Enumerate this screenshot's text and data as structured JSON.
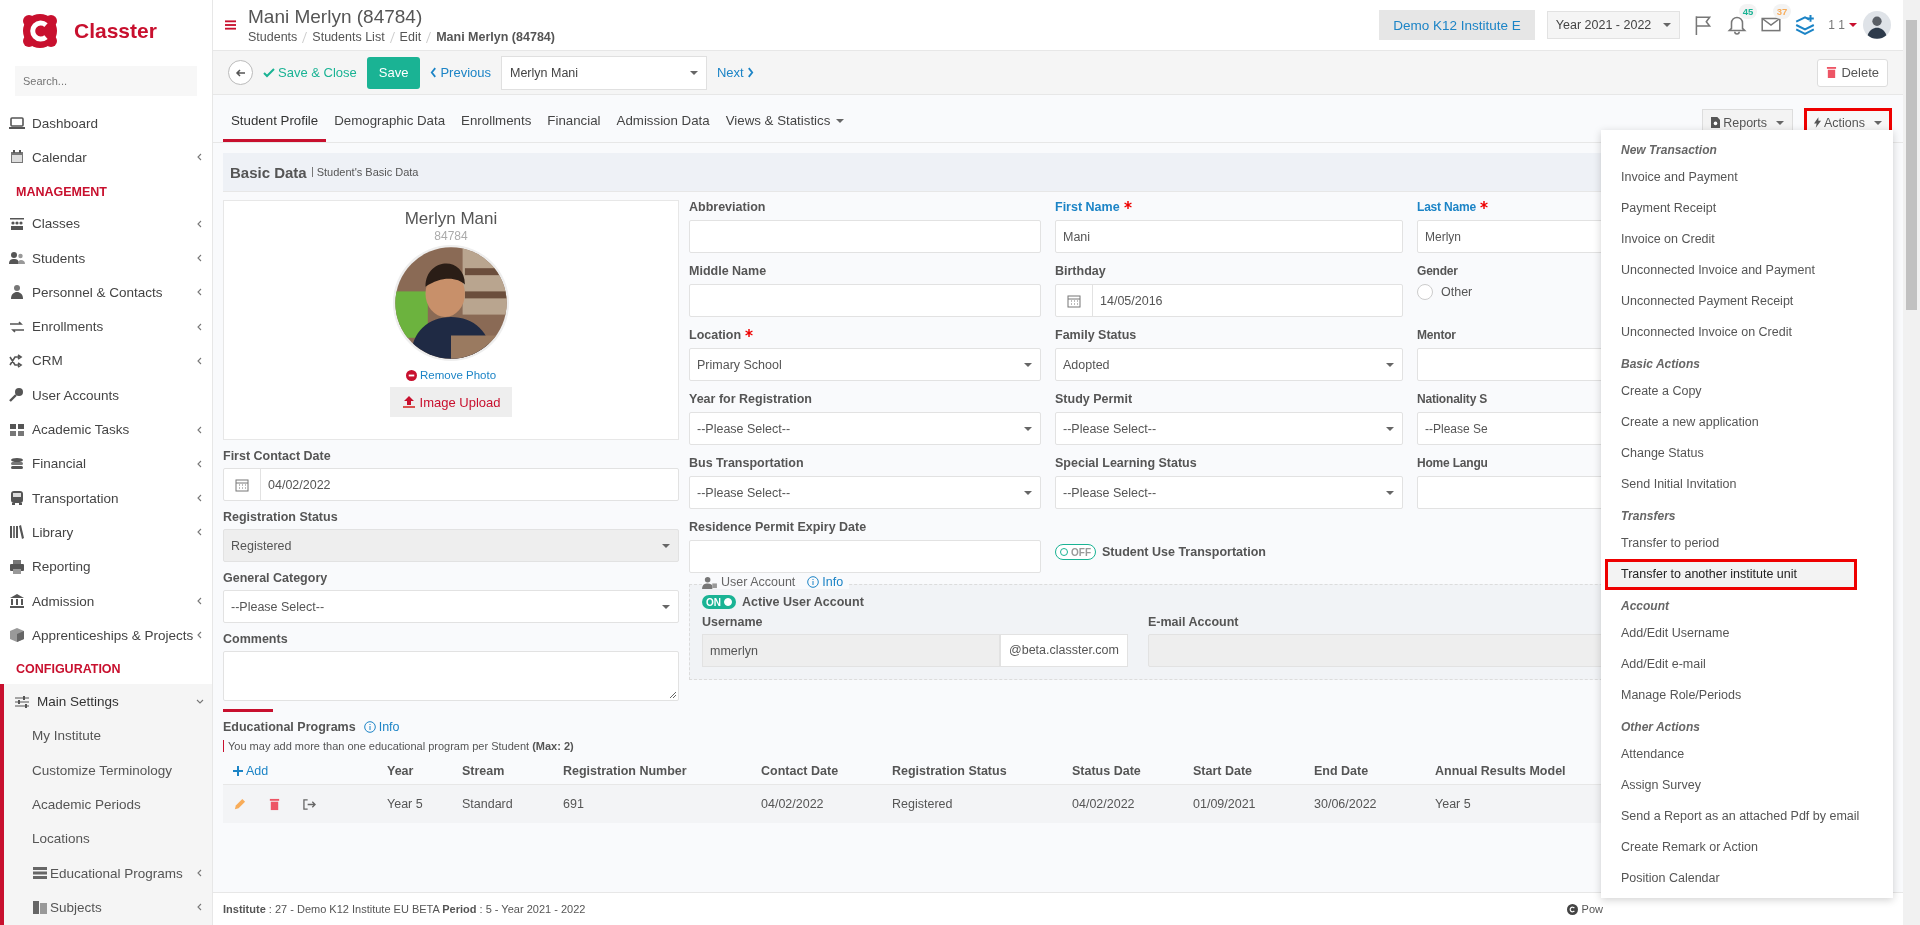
{
  "sidebar": {
    "logo": "Classter",
    "search_placeholder": "Search...",
    "items": [
      {
        "kind": "link",
        "label": "Dashboard",
        "has_submenu": false,
        "selected": false
      },
      {
        "kind": "link",
        "label": "Calendar",
        "has_submenu": true,
        "selected": false
      },
      {
        "kind": "heading",
        "label": "MANAGEMENT"
      },
      {
        "kind": "link",
        "label": "Classes",
        "has_submenu": true,
        "selected": false
      },
      {
        "kind": "link",
        "label": "Students",
        "has_submenu": true,
        "selected": false
      },
      {
        "kind": "link",
        "label": "Personnel & Contacts",
        "has_submenu": true,
        "selected": false
      },
      {
        "kind": "link",
        "label": "Enrollments",
        "has_submenu": true,
        "selected": false
      },
      {
        "kind": "link",
        "label": "CRM",
        "has_submenu": true,
        "selected": false
      },
      {
        "kind": "link",
        "label": "User Accounts",
        "has_submenu": false,
        "selected": false
      },
      {
        "kind": "link",
        "label": "Academic Tasks",
        "has_submenu": true,
        "selected": false
      },
      {
        "kind": "link",
        "label": "Financial",
        "has_submenu": true,
        "selected": false
      },
      {
        "kind": "link",
        "label": "Transportation",
        "has_submenu": true,
        "selected": false
      },
      {
        "kind": "link",
        "label": "Library",
        "has_submenu": true,
        "selected": false
      },
      {
        "kind": "link",
        "label": "Reporting",
        "has_submenu": false,
        "selected": false
      },
      {
        "kind": "link",
        "label": "Admission",
        "has_submenu": true,
        "selected": false
      },
      {
        "kind": "link",
        "label": "Apprenticeships & Projects",
        "has_submenu": true,
        "selected": false
      },
      {
        "kind": "heading",
        "label": "CONFIGURATION"
      },
      {
        "kind": "link",
        "label": "Main Settings",
        "has_submenu": true,
        "expanded": true,
        "selected": true,
        "children": [
          {
            "label": "My Institute",
            "has_submenu": false
          },
          {
            "label": "Customize Terminology",
            "has_submenu": false
          },
          {
            "label": "Academic Periods",
            "has_submenu": false
          },
          {
            "label": "Locations",
            "has_submenu": false
          },
          {
            "label": "Educational Programs",
            "has_submenu": true
          },
          {
            "label": "Subjects",
            "has_submenu": true
          }
        ]
      }
    ]
  },
  "header": {
    "title": "Mani Merlyn (84784)",
    "breadcrumb": [
      "Students",
      "Students List",
      "Edit",
      "Mani Merlyn (84784)"
    ],
    "institute": "Demo K12 Institute E",
    "year": "Year 2021 - 2022",
    "notifications": [
      {
        "kind": "bell",
        "count": "45",
        "color": "#1ab394"
      },
      {
        "kind": "mail",
        "count": "37",
        "color": "#f8ac59"
      }
    ],
    "user": "1 1"
  },
  "toolbar": {
    "save_close": "Save & Close",
    "save": "Save",
    "previous": "Previous",
    "student": "Merlyn Mani",
    "next": "Next",
    "delete": "Delete"
  },
  "tabs": [
    {
      "label": "Student Profile",
      "selected": true,
      "dropdown": false
    },
    {
      "label": "Demographic Data",
      "selected": false,
      "dropdown": false
    },
    {
      "label": "Enrollments",
      "selected": false,
      "dropdown": false
    },
    {
      "label": "Financial",
      "selected": false,
      "dropdown": false
    },
    {
      "label": "Admission Data",
      "selected": false,
      "dropdown": false
    },
    {
      "label": "Views & Statistics",
      "selected": false,
      "dropdown": true
    }
  ],
  "reports": "Reports",
  "actions": {
    "label": "Actions",
    "highlighted": true
  },
  "section": {
    "title": "Basic Data",
    "subtitle": "Student's Basic Data"
  },
  "profile": {
    "name": "Merlyn Mani",
    "id": "84784",
    "remove_photo": "Remove Photo",
    "image_upload": "Image Upload"
  },
  "left_fields": [
    {
      "label": "First Contact Date",
      "kind": "date",
      "value": "04/02/2022",
      "disabled": false
    },
    {
      "label": "Registration Status",
      "kind": "select",
      "value": "Registered",
      "disabled": true
    },
    {
      "label": "General Category",
      "kind": "select",
      "value": "--Please Select--",
      "disabled": false
    },
    {
      "label": "Comments",
      "kind": "textarea",
      "disabled": false
    }
  ],
  "fields": [
    {
      "label": "Abbreviation",
      "required": false,
      "highlight": false,
      "kind": "text"
    },
    {
      "label": "First Name",
      "required": true,
      "highlight": true,
      "kind": "text",
      "value": "Mani"
    },
    {
      "label": "Last Name",
      "required": true,
      "highlight": true,
      "kind": "text",
      "value": "Merlyn"
    },
    {
      "label": "Middle Name",
      "required": false,
      "highlight": false,
      "kind": "text"
    },
    {
      "label": "Birthday",
      "required": false,
      "highlight": false,
      "kind": "date",
      "value": "14/05/2016"
    },
    {
      "label": "Gender",
      "required": false,
      "highlight": false,
      "kind": "radio",
      "options": [
        {
          "label": "Other",
          "checked": false
        }
      ]
    },
    {
      "label": "Location",
      "required": true,
      "highlight": false,
      "kind": "select",
      "value": "Primary School"
    },
    {
      "label": "Family Status",
      "required": false,
      "highlight": false,
      "kind": "select",
      "value": "Adopted"
    },
    {
      "label": "Mentor",
      "required": false,
      "highlight": false,
      "kind": "text"
    },
    {
      "label": "Year for Registration",
      "required": false,
      "highlight": false,
      "kind": "select",
      "value": "--Please Select--"
    },
    {
      "label": "Study Permit",
      "required": false,
      "highlight": false,
      "kind": "select",
      "value": "--Please Select--"
    },
    {
      "label": "Nationality S",
      "required": false,
      "highlight": false,
      "kind": "select",
      "value": "--Please Se"
    },
    {
      "label": "Bus Transportation",
      "required": false,
      "highlight": false,
      "kind": "select",
      "value": "--Please Select--"
    },
    {
      "label": "Special Learning Status",
      "required": false,
      "highlight": false,
      "kind": "select",
      "value": "--Please Select--"
    },
    {
      "label": "Home Langu",
      "required": false,
      "highlight": false,
      "kind": "text"
    },
    {
      "label": "Residence Permit Expiry Date",
      "required": false,
      "highlight": false,
      "kind": "text"
    },
    {
      "label": "Student Use Transportation",
      "kind": "toggle",
      "on": false,
      "state_text": "OFF"
    }
  ],
  "user_account": {
    "title": "User Account",
    "info": "Info",
    "active_label": "Active User Account",
    "active": true,
    "state_text": "ON",
    "username_label": "Username",
    "username": "mmerlyn",
    "domain": "@beta.classter.com",
    "email_label": "E-mail Account"
  },
  "programs": {
    "title": "Educational Programs",
    "info": "Info",
    "note": "You may add more than one educational program per Student **(Max: 2)**",
    "add": "Add",
    "columns": [
      "Year",
      "Stream",
      "Registration Number",
      "Contact Date",
      "Registration Status",
      "Status Date",
      "Start Date",
      "End Date",
      "Annual Results Model"
    ],
    "rows": [
      [
        "Year 5",
        "Standard",
        "691",
        "04/02/2022",
        "Registered",
        "04/02/2022",
        "01/09/2021",
        "30/06/2022",
        "Year 5"
      ]
    ]
  },
  "status_bar": {
    "text": "**Institute** : 27 - Demo K12 Institute EU BETA **Period** : 5 - Year 2021 - 2022",
    "powered": "Pow"
  },
  "actions_menu": {
    "groups": [
      {
        "heading": "New Transaction",
        "items": [
          {
            "label": "Invoice and Payment",
            "highlighted": false
          },
          {
            "label": "Payment Receipt",
            "highlighted": false
          },
          {
            "label": "Invoice on Credit",
            "highlighted": false
          },
          {
            "label": "Unconnected Invoice and Payment",
            "highlighted": false
          },
          {
            "label": "Unconnected Payment Receipt",
            "highlighted": false
          },
          {
            "label": "Unconnected Invoice on Credit",
            "highlighted": false
          }
        ]
      },
      {
        "heading": "Basic Actions",
        "items": [
          {
            "label": "Create a Copy",
            "highlighted": false
          },
          {
            "label": "Create a new application",
            "highlighted": false
          },
          {
            "label": "Change Status",
            "highlighted": false
          },
          {
            "label": "Send Initial Invitation",
            "highlighted": false
          }
        ]
      },
      {
        "heading": "Transfers",
        "items": [
          {
            "label": "Transfer to period",
            "highlighted": false
          },
          {
            "label": "Transfer to another institute unit",
            "highlighted": true
          }
        ]
      },
      {
        "heading": "Account",
        "items": [
          {
            "label": "Add/Edit Username",
            "highlighted": false
          },
          {
            "label": "Add/Edit e-mail",
            "highlighted": false
          },
          {
            "label": "Manage Role/Periods",
            "highlighted": false
          }
        ]
      },
      {
        "heading": "Other Actions",
        "items": [
          {
            "label": "Attendance",
            "highlighted": false
          },
          {
            "label": "Assign Survey",
            "highlighted": false
          },
          {
            "label": "Send a Report as an attached Pdf by email",
            "highlighted": false
          },
          {
            "label": "Create Remark or Action",
            "highlighted": false
          },
          {
            "label": "Position Calendar",
            "highlighted": false
          }
        ]
      }
    ]
  }
}
